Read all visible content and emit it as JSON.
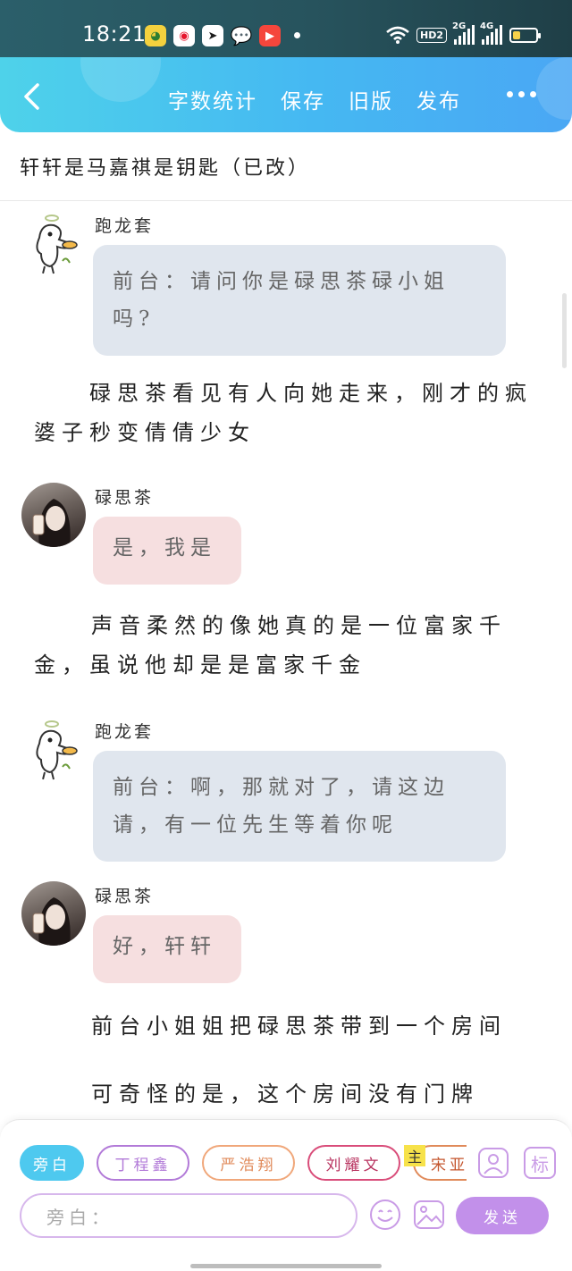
{
  "status_bar": {
    "time": "18:21",
    "hd_label": "HD2",
    "signal_1_label": "2G",
    "signal_2_label": "4G",
    "battery_level": 0.35,
    "battery_color": "#f6d24a"
  },
  "header": {
    "actions": [
      "字数统计",
      "保存",
      "旧版",
      "发布"
    ],
    "colors": {
      "start": "#4ed2ea",
      "end": "#4aa7f4"
    }
  },
  "document": {
    "title": "轩轩是马嘉祺是钥匙（已改）"
  },
  "content": [
    {
      "type": "dialogue",
      "speaker": "跑龙套",
      "text": "前台：请问你是碌思茶碌小姐吗?",
      "style": "blue",
      "avatar": "duck-avatar"
    },
    {
      "type": "narration",
      "text": "碌思茶看见有人向她走来，刚才的疯婆子秒变倩倩少女"
    },
    {
      "type": "dialogue",
      "speaker": "碌思茶",
      "text": "是，我是",
      "style": "pink",
      "avatar": "girl-avatar"
    },
    {
      "type": "narration",
      "text": "声音柔然的像她真的是一位富家千金，虽说他却是是富家千金"
    },
    {
      "type": "dialogue",
      "speaker": "跑龙套",
      "text": "前台：啊，那就对了，请这边请，有一位先生等着你呢",
      "style": "blue",
      "avatar": "duck-avatar"
    },
    {
      "type": "dialogue",
      "speaker": "碌思茶",
      "text": "好，轩轩",
      "style": "pink",
      "avatar": "girl-avatar"
    },
    {
      "type": "narration",
      "text": "前台小姐姐把碌思茶带到一个房间"
    },
    {
      "type": "narration",
      "text": "可奇怪的是，这个房间没有门牌"
    }
  ],
  "bottom": {
    "roles": [
      {
        "label": "旁白",
        "color": "#4ec9ef",
        "active": true
      },
      {
        "label": "丁程鑫",
        "color": "#b27ad8",
        "active": false
      },
      {
        "label": "严浩翔",
        "color": "#f0a77a",
        "active": false
      },
      {
        "label": "刘耀文",
        "color": "#d94d7a",
        "active": false
      },
      {
        "label": "宋亚",
        "color": "#e08a5a",
        "active": false
      }
    ],
    "main_tag": "主",
    "mark_label": "标",
    "input_placeholder": "旁白：",
    "send_label": "发送"
  }
}
